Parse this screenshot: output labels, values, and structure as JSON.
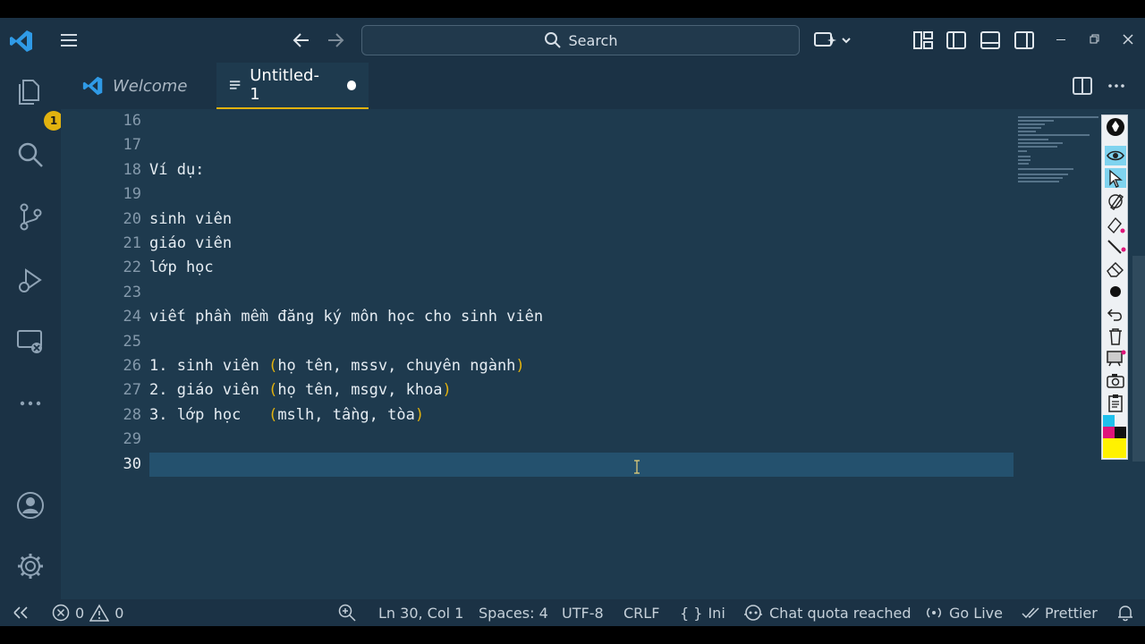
{
  "titlebar": {
    "search_placeholder": "Search"
  },
  "activitybar": {
    "explorer_badge": "1"
  },
  "tabs": {
    "welcome_label": "Welcome",
    "untitled_label": "Untitled-1"
  },
  "editor": {
    "line_numbers": [
      "16",
      "17",
      "18",
      "19",
      "20",
      "21",
      "22",
      "23",
      "24",
      "25",
      "26",
      "27",
      "28",
      "29",
      "30"
    ],
    "lines": {
      "l18": "Ví dụ:",
      "l20": "sinh viên",
      "l21": "giáo viên",
      "l22": "lớp học",
      "l24": "viết phần mềm đăng ký môn học cho sinh viên",
      "l26_prefix": "1. sinh viên ",
      "l26_inner": "họ tên, mssv, chuyên ngành",
      "l27_prefix": "2. giáo viên ",
      "l27_inner": "họ tên, msgv, khoa",
      "l28_prefix": "3. lớp học   ",
      "l28_inner": "mslh, tầng, tòa",
      "open_paren": "(",
      "close_paren": ")"
    }
  },
  "statusbar": {
    "errors": "0",
    "warnings": "0",
    "position": "Ln 30, Col 1",
    "spaces": "Spaces: 4",
    "encoding": "UTF-8",
    "eol": "CRLF",
    "language": "Ini",
    "language_icon": "{ }",
    "chat": "Chat quota reached",
    "golive": "Go Live",
    "prettier": "Prettier"
  },
  "colors": {
    "background": "#1e3a4e",
    "chrome": "#1b3245",
    "accent": "#e2b20f",
    "current_line": "#24516e"
  }
}
